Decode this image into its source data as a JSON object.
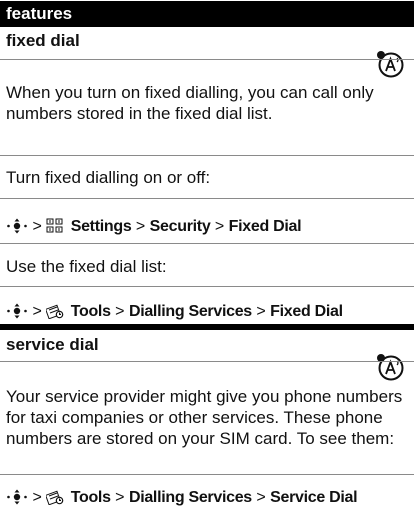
{
  "header": {
    "title": "features"
  },
  "fixed_dial": {
    "title": "fixed dial",
    "badge_icon": "network-feature-icon",
    "intro": "When you turn on fixed dialling, you can call only numbers stored in the fixed dial list.",
    "toggle_label": "Turn fixed dialling on or off:",
    "toggle_path": {
      "sep": ">",
      "icon": "settings-icon",
      "steps": [
        "Settings",
        "Security",
        "Fixed Dial"
      ]
    },
    "list_label": "Use the fixed dial list:",
    "list_path": {
      "icon": "tools-icon",
      "steps": [
        "Tools",
        "Dialling Services",
        "Fixed Dial"
      ]
    }
  },
  "service_dial": {
    "title": "service dial",
    "badge_icon": "network-feature-icon",
    "intro": "Your service provider might give you phone numbers for taxi companies or other services. These phone numbers are stored on your SIM card. To see them:",
    "path": {
      "icon": "tools-icon",
      "steps": [
        "Tools",
        "Dialling Services",
        "Service Dial"
      ]
    }
  }
}
